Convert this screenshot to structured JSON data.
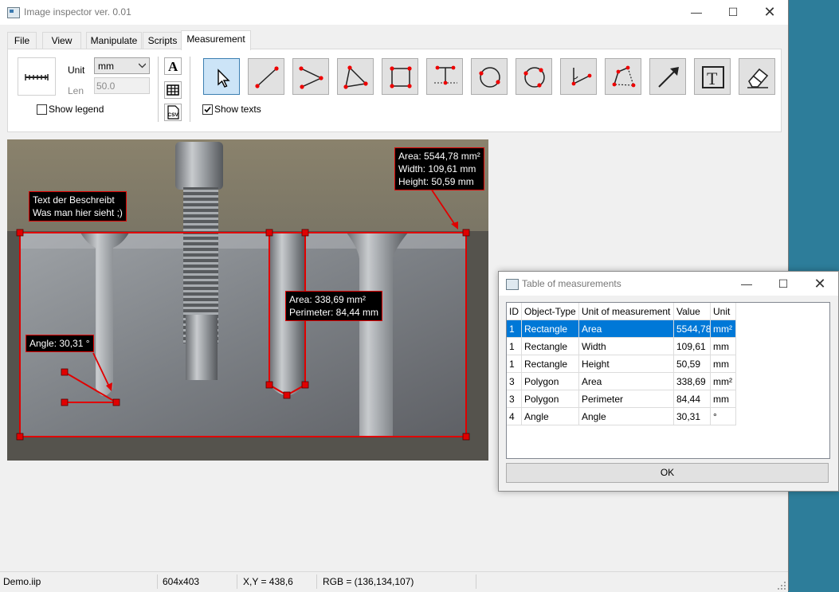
{
  "window": {
    "title": "Image inspector ver. 0.01",
    "controls": [
      "minimize-icon",
      "maximize-icon",
      "close-icon"
    ]
  },
  "menu_tabs": [
    "File",
    "View",
    "Manipulate",
    "Scripts",
    "Measurement"
  ],
  "active_tab": "Measurement",
  "ribbon": {
    "unit_label": "Unit",
    "unit_value": "mm",
    "len_label": "Len",
    "len_placeholder": "50.0",
    "show_legend_label": "Show legend",
    "show_legend_checked": false,
    "show_texts_label": "Show texts",
    "show_texts_checked": true,
    "tools": [
      "pointer-tool",
      "line-tool",
      "polyline-tool",
      "triangle-tool",
      "rectangle-tool",
      "perpendicular-tool",
      "circle-tool",
      "circle-3point-tool",
      "angle-tool",
      "polygon-tool",
      "arrow-tool",
      "text-tool",
      "eraser-tool"
    ],
    "small_buttons": [
      "font-icon",
      "table-icon",
      "csv-icon"
    ]
  },
  "canvas": {
    "annotations": {
      "description_line1": "Text der Beschreibt",
      "description_line2": "Was man hier sieht ;)",
      "rect_area": "Area: 5544,78 mm²",
      "rect_width": "Width: 109,61 mm",
      "rect_height": "Height: 50,59 mm",
      "poly_area": "Area: 338,69 mm²",
      "poly_perimeter": "Perimeter: 84,44 mm",
      "angle": "Angle: 30,31 °"
    }
  },
  "status_bar": {
    "file": "Demo.iip",
    "size": "604x403",
    "coords": "X,Y = 438,6",
    "rgb": "RGB = (136,134,107)"
  },
  "dialog": {
    "title": "Table of measurements",
    "columns": [
      "ID",
      "Object-Type",
      "Unit of measurement",
      "Value",
      "Unit"
    ],
    "rows": [
      [
        "1",
        "Rectangle",
        "Area",
        "5544,78",
        "mm²"
      ],
      [
        "1",
        "Rectangle",
        "Width",
        "109,61",
        "mm"
      ],
      [
        "1",
        "Rectangle",
        "Height",
        "50,59",
        "mm"
      ],
      [
        "3",
        "Polygon",
        "Area",
        "338,69",
        "mm²"
      ],
      [
        "3",
        "Polygon",
        "Perimeter",
        "84,44",
        "mm"
      ],
      [
        "4",
        "Angle",
        "Angle",
        "30,31",
        "°"
      ]
    ],
    "selected_row": 0,
    "ok_label": "OK"
  },
  "colors": {
    "accent_selection": "#0078d7",
    "annotation_red": "#e00000",
    "desktop": "#2d7d9a"
  }
}
